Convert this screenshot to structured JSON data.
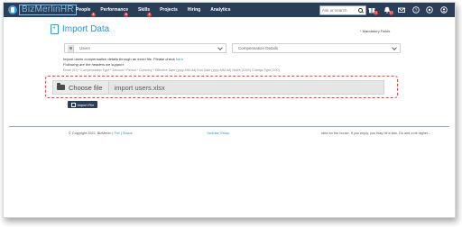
{
  "app": {
    "logo_text": "BizMerlinHR"
  },
  "nav": {
    "items": [
      {
        "label": "People",
        "badge": "8"
      },
      {
        "label": "Performance",
        "badge": "6"
      },
      {
        "label": "Skills",
        "badge": "2"
      },
      {
        "label": "Projects",
        "badge": ""
      },
      {
        "label": "Hiring",
        "badge": ""
      },
      {
        "label": "Analytics",
        "badge": ""
      }
    ]
  },
  "search": {
    "placeholder": "Ask or search"
  },
  "toolbar": {
    "icons": [
      {
        "name": "gift-icon",
        "badge": "11"
      },
      {
        "name": "bell-icon",
        "badge": "13"
      },
      {
        "name": "mail-icon",
        "badge": ""
      },
      {
        "name": "help-icon",
        "badge": ""
      },
      {
        "name": "settings-icon",
        "badge": ""
      },
      {
        "name": "user-menu-icon",
        "badge": ""
      }
    ]
  },
  "page": {
    "title": "Import Data",
    "mandatory_note": "* Mandatory Fields"
  },
  "form": {
    "entity_select": "Users",
    "type_select": "Compensation Details",
    "info_line": "Import users compensation details through an excel file. Please check ",
    "info_link": "here.",
    "headers_intro": "Following are the headers we support:",
    "headers_list": "Email (ID) * Compensation Type * Amount * Period * Currency * Effective Date (yyyy-MM-dd) End Date (yyyy-MM-dd) Notes (1000) Change Type (100)"
  },
  "upload": {
    "choose_label": "Choose file",
    "file_name": "import users.xlsx"
  },
  "actions": {
    "import_label": "Import File"
  },
  "footer": {
    "copyright": "© Copyright 2022, BizMerlin",
    "link1": "Poll",
    "link2": "Status",
    "mid_link": "Youtube Group",
    "right_text": "Idea for the house. If you enjoy, you may hit a star. Go and a bit higher..."
  },
  "colors": {
    "topbar": "#2a3e57",
    "accent": "#2c94c8",
    "highlight_border": "#e04646",
    "badge": "#e23b3b"
  }
}
